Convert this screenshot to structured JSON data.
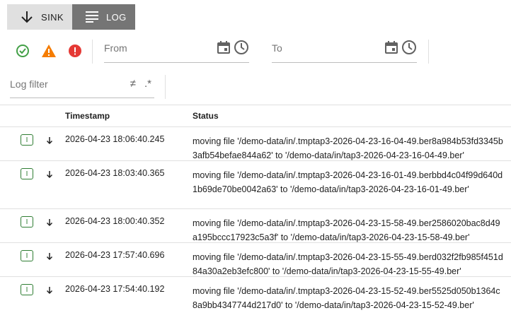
{
  "toolbar": {
    "sink_label": "SINK",
    "log_label": "LOG"
  },
  "filters": {
    "from_label": "From",
    "to_label": "To",
    "log_filter_placeholder": "Log filter",
    "not_equal_symbol": "≠",
    "regex_symbol": ".*"
  },
  "table": {
    "headers": {
      "timestamp": "Timestamp",
      "status": "Status"
    },
    "rows": [
      {
        "level": "I",
        "timestamp": "2026-04-23 18:06:40.245",
        "status": "moving file '/demo-data/in/.tmptap3-2026-04-23-16-04-49.ber8a984b53fd3345b3afb54befae844a62' to '/demo-data/in/tap3-2026-04-23-16-04-49.ber'"
      },
      {
        "level": "I",
        "timestamp": "2026-04-23 18:03:40.365",
        "status": "moving file '/demo-data/in/.tmptap3-2026-04-23-16-01-49.berbbd4c04f99d640d1b69de70be0042a63' to '/demo-data/in/tap3-2026-04-23-16-01-49.ber'"
      },
      {
        "level": "I",
        "timestamp": "2026-04-23 18:00:40.352",
        "status": "moving file '/demo-data/in/.tmptap3-2026-04-23-15-58-49.ber2586020bac8d49a195bccc17923c5a3f' to '/demo-data/in/tap3-2026-04-23-15-58-49.ber'"
      },
      {
        "level": "I",
        "timestamp": "2026-04-23 17:57:40.696",
        "status": "moving file '/demo-data/in/.tmptap3-2026-04-23-15-55-49.berd032f2fb985f451d84a30a2eb3efc800' to '/demo-data/in/tap3-2026-04-23-15-55-49.ber'"
      },
      {
        "level": "I",
        "timestamp": "2026-04-23 17:54:40.192",
        "status": "moving file '/demo-data/in/.tmptap3-2026-04-23-15-52-49.ber5525d050b1364c8a9bb4347744d217d0' to '/demo-data/in/tap3-2026-04-23-15-52-49.ber'"
      }
    ]
  },
  "colors": {
    "success": "#43a047",
    "warning": "#f57c00",
    "error": "#e53935",
    "info_badge": "#2e7d32"
  }
}
